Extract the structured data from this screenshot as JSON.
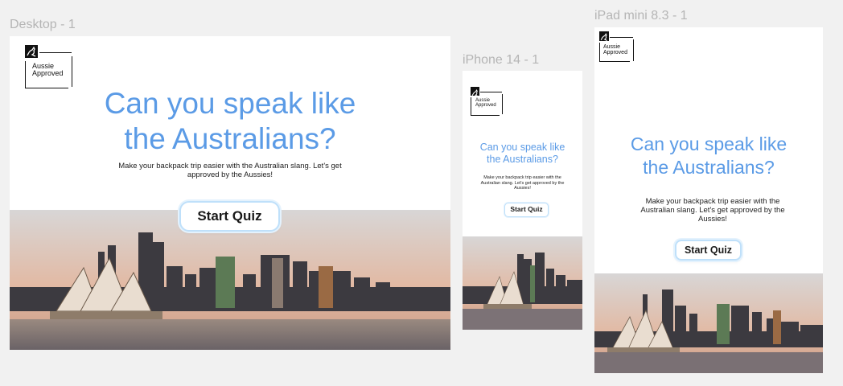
{
  "frames": {
    "desktop": {
      "label": "Desktop - 1"
    },
    "iphone": {
      "label": "iPhone 14 - 1"
    },
    "ipad": {
      "label": "iPad mini 8.3 - 1"
    }
  },
  "content": {
    "logo_line1": "Aussie",
    "logo_line2": "Approved",
    "headline_line1": "Can you speak like",
    "headline_line2": "the Australians?",
    "subtext": "Make your backpack trip easier with the Australian slang. Let's get approved by the Aussies!",
    "button_label": "Start Quiz"
  },
  "colors": {
    "canvas": "#f1f1f1",
    "headline": "#5b9be6",
    "button_border": "#bfe0fa"
  },
  "icons": {
    "logo": "kangaroo-icon"
  }
}
